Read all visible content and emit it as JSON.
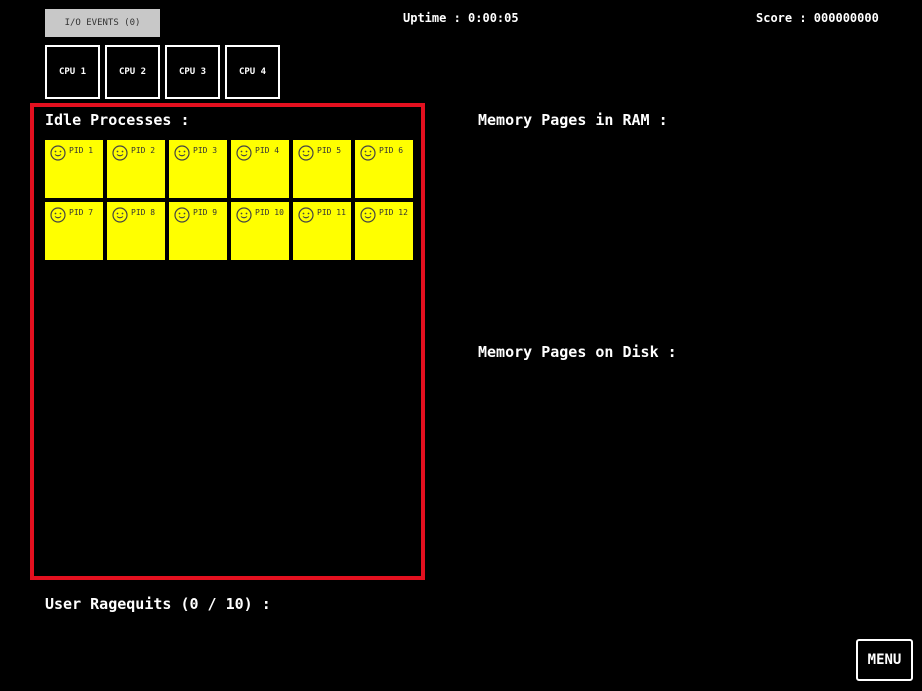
{
  "header": {
    "io_button_label": "I/O EVENTS (0)",
    "uptime": "Uptime : 0:00:05",
    "score": "Score : 000000000"
  },
  "cpus": [
    "CPU 1",
    "CPU 2",
    "CPU 3",
    "CPU 4"
  ],
  "idle": {
    "title": "Idle Processes :",
    "processes": [
      "PID 1",
      "PID 2",
      "PID 3",
      "PID 4",
      "PID 5",
      "PID 6",
      "PID 7",
      "PID 8",
      "PID 9",
      "PID 10",
      "PID 11",
      "PID 12"
    ],
    "panel_border_color": "#e3101f",
    "process_color": "#ffff00",
    "process_icon": "smiley-face-icon"
  },
  "memory": {
    "ram_title": "Memory Pages in RAM :",
    "disk_title": "Memory Pages on Disk :"
  },
  "footer": {
    "ragequits": "User Ragequits (0 / 10) :",
    "menu_label": "MENU"
  }
}
